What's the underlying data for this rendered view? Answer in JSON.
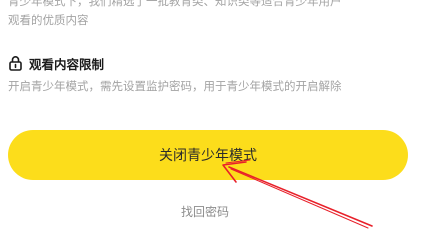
{
  "intro": {
    "line1": "青少年模式下，我们精选了一批教育类、知识类等适合青少年用户",
    "line2": "观看的优质内容"
  },
  "restriction": {
    "icon": "lock-icon",
    "title": "观看内容限制",
    "description": "开启青少年模式，需先设置监护密码，用于青少年模式的开启解除"
  },
  "actions": {
    "close_teen_mode": "关闭青少年模式",
    "recover_password": "找回密码"
  },
  "colors": {
    "button_bg": "#fcdd1b",
    "annotation_arrow": "#e8202a",
    "secondary_text": "#a3a3a3"
  }
}
